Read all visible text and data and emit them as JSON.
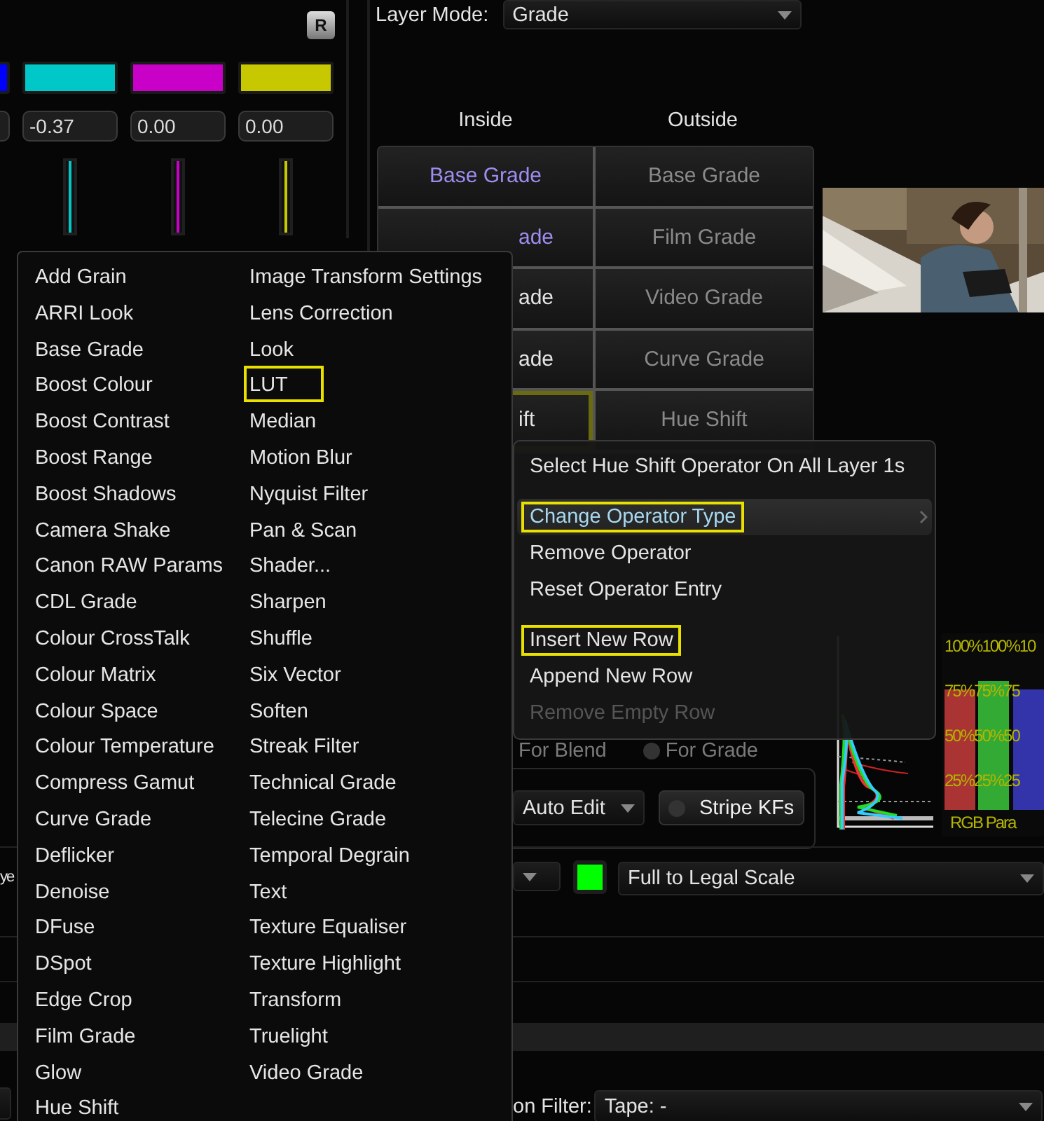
{
  "reset_button": {
    "label": "R"
  },
  "channels": [
    {
      "color": "#0000ff"
    },
    {
      "color": "#00c8c8",
      "value": "-0.37"
    },
    {
      "color": "#c800c8",
      "value": "0.00"
    },
    {
      "color": "#c8c800",
      "value": "0.00"
    }
  ],
  "layer_mode": {
    "label": "Layer Mode:",
    "value": "Grade"
  },
  "grade_table": {
    "columns": [
      "Inside",
      "Outside"
    ],
    "rows": [
      {
        "inside": {
          "text": "Base Grade",
          "kind": "full",
          "on": true,
          "selected": false
        },
        "outside": "Base Grade"
      },
      {
        "inside": {
          "text": "ade",
          "kind": "partial",
          "on": true,
          "selected": false
        },
        "outside": "Film Grade"
      },
      {
        "inside": {
          "text": "ade",
          "kind": "partial",
          "on": false,
          "selected": false
        },
        "outside": "Video Grade"
      },
      {
        "inside": {
          "text": "ade",
          "kind": "partial",
          "on": false,
          "selected": false
        },
        "outside": "Curve Grade"
      },
      {
        "inside": {
          "text": "ift",
          "kind": "partial",
          "on": false,
          "selected": true
        },
        "outside": "Hue Shift"
      }
    ]
  },
  "blend_options": [
    "For Blend",
    "For Grade"
  ],
  "auto_edit": {
    "value": "Auto Edit"
  },
  "stripe_kfs": {
    "label": "Stripe KFs",
    "on": false
  },
  "scope": {
    "labels": [
      "100%100%10",
      "75%75%75",
      "50%50%50",
      "25%25%25"
    ],
    "title": "RGB Para"
  },
  "scale_row": {
    "cut_label": "ye",
    "swatch": {
      "color": "#00ff00"
    },
    "value": "Full to Legal Scale"
  },
  "filter_row": {
    "label": "on Filter:",
    "value": "Tape: -"
  },
  "operator_menu": {
    "columns": [
      [
        {
          "label": "Add Grain",
          "marked": false
        },
        {
          "label": "ARRI Look",
          "marked": false
        },
        {
          "label": "Base Grade",
          "marked": false
        },
        {
          "label": "Boost Colour",
          "marked": false
        },
        {
          "label": "Boost Contrast",
          "marked": false
        },
        {
          "label": "Boost Range",
          "marked": false
        },
        {
          "label": "Boost Shadows",
          "marked": false
        },
        {
          "label": "Camera Shake",
          "marked": false
        },
        {
          "label": "Canon RAW Params",
          "marked": false
        },
        {
          "label": "CDL Grade",
          "marked": false
        },
        {
          "label": "Colour CrossTalk",
          "marked": false
        },
        {
          "label": "Colour Matrix",
          "marked": false
        },
        {
          "label": "Colour Space",
          "marked": false
        },
        {
          "label": "Colour Temperature",
          "marked": false
        },
        {
          "label": "Compress Gamut",
          "marked": false
        },
        {
          "label": "Curve Grade",
          "marked": false
        },
        {
          "label": "Deflicker",
          "marked": false
        },
        {
          "label": "Denoise",
          "marked": false
        },
        {
          "label": "DFuse",
          "marked": false
        },
        {
          "label": "DSpot",
          "marked": false
        },
        {
          "label": "Edge Crop",
          "marked": false
        },
        {
          "label": "Film Grade",
          "marked": false
        },
        {
          "label": "Glow",
          "marked": false
        },
        {
          "label": "Hue Shift",
          "marked": false
        }
      ],
      [
        {
          "label": "Image Transform Settings",
          "marked": false
        },
        {
          "label": "Lens Correction",
          "marked": false
        },
        {
          "label": "Look",
          "marked": false
        },
        {
          "label": "LUT",
          "marked": true
        },
        {
          "label": "Median",
          "marked": false
        },
        {
          "label": "Motion Blur",
          "marked": false
        },
        {
          "label": "Nyquist Filter",
          "marked": false
        },
        {
          "label": "Pan & Scan",
          "marked": false
        },
        {
          "label": "Shader...",
          "marked": false
        },
        {
          "label": "Sharpen",
          "marked": false
        },
        {
          "label": "Shuffle",
          "marked": false
        },
        {
          "label": "Six Vector",
          "marked": false
        },
        {
          "label": "Soften",
          "marked": false
        },
        {
          "label": "Streak Filter",
          "marked": false
        },
        {
          "label": "Technical Grade",
          "marked": false
        },
        {
          "label": "Telecine Grade",
          "marked": false
        },
        {
          "label": "Temporal Degrain",
          "marked": false
        },
        {
          "label": "Text",
          "marked": false
        },
        {
          "label": "Texture Equaliser",
          "marked": false
        },
        {
          "label": "Texture Highlight",
          "marked": false
        },
        {
          "label": "Transform",
          "marked": false
        },
        {
          "label": "Truelight",
          "marked": false
        },
        {
          "label": "Video Grade",
          "marked": false
        }
      ]
    ]
  },
  "context_menu": {
    "groups": [
      [
        {
          "label": "Select Hue Shift Operator On All Layer 1s",
          "selected": false,
          "disabled": false,
          "marked": false,
          "submenu": false
        }
      ],
      [
        {
          "label": "Change Operator Type",
          "selected": true,
          "disabled": false,
          "marked": true,
          "submenu": true
        },
        {
          "label": "Remove Operator",
          "selected": false,
          "disabled": false,
          "marked": false,
          "submenu": false
        },
        {
          "label": "Reset Operator Entry",
          "selected": false,
          "disabled": false,
          "marked": false,
          "submenu": false
        }
      ],
      [
        {
          "label": "Insert New Row",
          "selected": false,
          "disabled": false,
          "marked": true,
          "submenu": false
        },
        {
          "label": "Append New Row",
          "selected": false,
          "disabled": false,
          "marked": false,
          "submenu": false
        },
        {
          "label": "Remove Empty Row",
          "selected": false,
          "disabled": true,
          "marked": false,
          "submenu": false
        }
      ]
    ]
  }
}
